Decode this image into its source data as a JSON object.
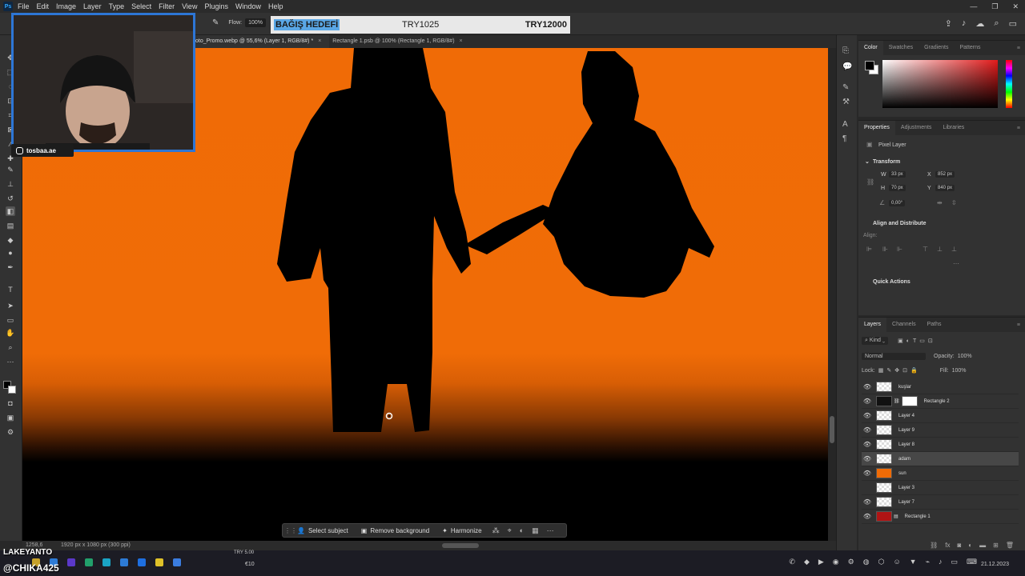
{
  "menubar": {
    "items": [
      "File",
      "Edit",
      "Image",
      "Layer",
      "Type",
      "Select",
      "Filter",
      "View",
      "Plugins",
      "Window",
      "Help"
    ],
    "logo": "Ps"
  },
  "options": {
    "flow_label": "Flow:",
    "flow_value": "100%"
  },
  "donation": {
    "title": "BAĞIŞ HEDEFİ",
    "current": "TRY1025",
    "goal": "TRY12000"
  },
  "tabs": [
    {
      "label": "oto_Promo.webp @ 55,6% (Layer 1, RGB/8#) *",
      "active": true
    },
    {
      "label": "Rectangle 1.psb @ 100% (Rectangle 1, RGB/8#)",
      "active": false
    }
  ],
  "webcam": {
    "handle": "tosbaa.ae"
  },
  "contextbar": {
    "select_subject": "Select subject",
    "remove_background": "Remove background",
    "harmonize": "Harmonize"
  },
  "status": {
    "zoom": "1258,6",
    "dims": "1920 px x 1080 px (300 ppi)"
  },
  "color_panel": {
    "tabs": [
      "Color",
      "Swatches",
      "Gradients",
      "Patterns"
    ],
    "fg": "#000000",
    "bg": "#ffffff"
  },
  "properties_panel": {
    "tabs": [
      "Properties",
      "Adjustments",
      "Libraries"
    ],
    "layer_type": "Pixel Layer",
    "transform_title": "Transform",
    "w": "33 px",
    "h": "70 px",
    "x": "852 px",
    "y": "840 px",
    "angle": "0,00°",
    "align_title": "Align and Distribute",
    "align_label": "Align:",
    "quick_actions": "Quick Actions"
  },
  "layers_panel": {
    "tabs": [
      "Layers",
      "Channels",
      "Paths"
    ],
    "kind": "Kind",
    "blend_mode": "Normal",
    "opacity_label": "Opacity:",
    "opacity": "100%",
    "lock_label": "Lock:",
    "fill_label": "Fill:",
    "fill": "100%",
    "layers": [
      {
        "name": "kuşlar",
        "selected": false,
        "visible": true
      },
      {
        "name": "Rectangle 2",
        "selected": false,
        "visible": true
      },
      {
        "name": "Layer 4",
        "selected": false,
        "visible": true
      },
      {
        "name": "Layer 9",
        "selected": false,
        "visible": true
      },
      {
        "name": "Layer 8",
        "selected": false,
        "visible": true
      },
      {
        "name": "adam",
        "selected": true,
        "visible": true
      },
      {
        "name": "sun",
        "selected": false,
        "visible": true
      },
      {
        "name": "Layer 3",
        "selected": false,
        "visible": false
      },
      {
        "name": "Layer 7",
        "selected": false,
        "visible": true
      },
      {
        "name": "Rectangle 1",
        "selected": false,
        "visible": true
      }
    ]
  },
  "taskbar": {
    "price_top": "TRY 5.00",
    "price": "€10",
    "time": "21.12.2023"
  },
  "overlay": {
    "handle": "LAKEYANTO",
    "nick": "@CHIKA425"
  }
}
